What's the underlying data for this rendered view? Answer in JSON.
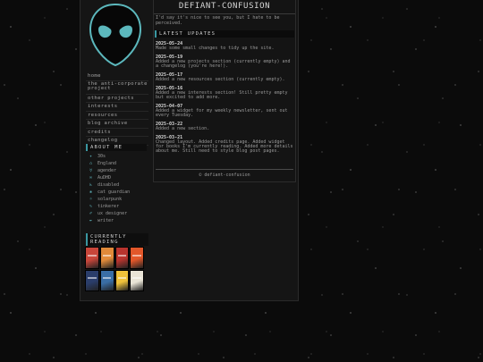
{
  "site": {
    "title": "DEFIANT-CONFUSION",
    "intro": "I'd say it's nice to see you, but I hate to be perceived.",
    "footer": "© defiant-confusion"
  },
  "nav": {
    "items": [
      {
        "label": "home"
      },
      {
        "label": "the anti-corporate project"
      },
      {
        "label": "other projects"
      },
      {
        "label": "interests"
      },
      {
        "label": "resources"
      },
      {
        "label": "blog archive"
      },
      {
        "label": "credits"
      },
      {
        "label": "changelog"
      }
    ]
  },
  "about": {
    "title": "ABOUT ME",
    "items": [
      {
        "label": "30s",
        "icon": "birthday-icon"
      },
      {
        "label": "England",
        "icon": "location-icon"
      },
      {
        "label": "agender",
        "icon": "gender-icon"
      },
      {
        "label": "AuDHD",
        "icon": "infinity-icon"
      },
      {
        "label": "disabled",
        "icon": "accessibility-icon"
      },
      {
        "label": "cat guardian",
        "icon": "paw-icon"
      },
      {
        "label": "solarpunk",
        "icon": "sun-icon"
      },
      {
        "label": "tinkerer",
        "icon": "wrench-icon"
      },
      {
        "label": "ux designer",
        "icon": "pencil-icon"
      },
      {
        "label": "writer",
        "icon": "quill-icon"
      }
    ]
  },
  "reading": {
    "title": "CURRENTLY READING",
    "books": [
      {
        "name": "book-1",
        "color": "#c8463a"
      },
      {
        "name": "book-2",
        "color": "#e08a3a"
      },
      {
        "name": "book-3",
        "color": "#b8342e"
      },
      {
        "name": "book-4",
        "color": "#e2572a"
      },
      {
        "name": "book-5",
        "color": "#2a3d6a"
      },
      {
        "name": "book-6",
        "color": "#3a6ea5"
      },
      {
        "name": "book-7",
        "color": "#f0c23a"
      },
      {
        "name": "book-8",
        "color": "#e9e4d6"
      }
    ]
  },
  "updates": {
    "title": "LATEST UPDATES",
    "entries": [
      {
        "date": "2025-05-24",
        "text": "Made some small changes to tidy up the site."
      },
      {
        "date": "2025-05-19",
        "text": "Added a new projects section (currently empty) and a changelog (you're here!)."
      },
      {
        "date": "2025-05-17",
        "text": "Added a new resources section (currently empty)."
      },
      {
        "date": "2025-05-16",
        "text": "Added a new interests section! Still pretty empty but excited to add more."
      },
      {
        "date": "2025-04-07",
        "text": "Added a widget for my weekly newsletter, sent out every Tuesday."
      },
      {
        "date": "2025-03-22",
        "text": "Added a new section."
      },
      {
        "date": "2025-03-21",
        "text": "Changed layout. Added credits page. Added widget for books I'm currently reading. Added more details about me. Still need to style blog post pages."
      }
    ]
  },
  "colors": {
    "accent": "#3a97a1",
    "alien": "#5cb8bd",
    "background": "#0b0b0b"
  }
}
